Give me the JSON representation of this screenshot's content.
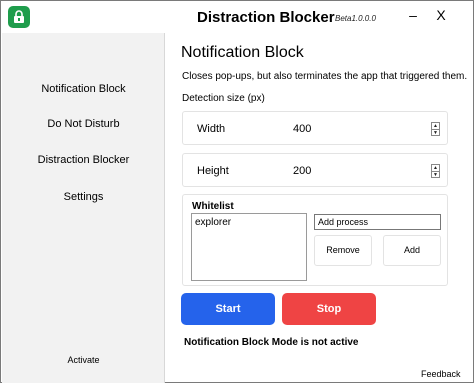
{
  "window": {
    "title": "Distraction Blocker",
    "version": "Beta1.0.0.0",
    "minimize_label": "–",
    "close_label": "X"
  },
  "sidebar": {
    "items": [
      {
        "label": "Notification Block"
      },
      {
        "label": "Do Not Disturb"
      },
      {
        "label": "Distraction Blocker"
      },
      {
        "label": "Settings"
      }
    ],
    "activate_label": "Activate"
  },
  "main": {
    "title": "Notification Block",
    "description": "Closes pop-ups, but also terminates the app that triggered them.",
    "detection_label": "Detection size (px)",
    "width": {
      "label": "Width",
      "value": "400"
    },
    "height": {
      "label": "Height",
      "value": "200"
    },
    "whitelist": {
      "label": "Whitelist",
      "items": [
        "explorer"
      ],
      "input_placeholder": "Add process",
      "remove_label": "Remove",
      "add_label": "Add"
    },
    "start_label": "Start",
    "stop_label": "Stop",
    "status": "Notification Block Mode is not active"
  },
  "footer": {
    "feedback_label": "Feedback"
  },
  "colors": {
    "start": "#2563eb",
    "stop": "#ef4444",
    "app_icon": "#1f9d4c"
  }
}
